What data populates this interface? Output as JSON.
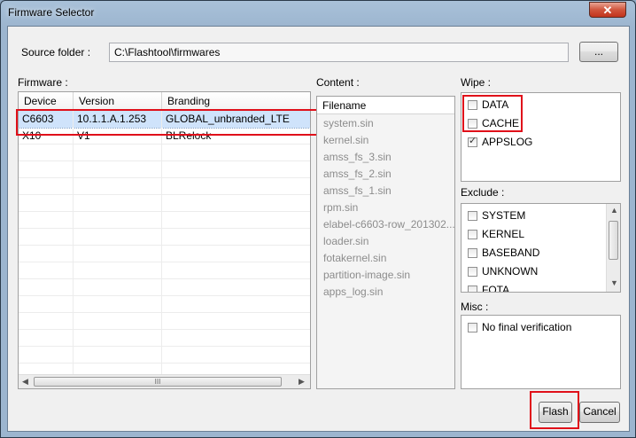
{
  "window": {
    "title": "Firmware Selector",
    "close_glyph": "✕"
  },
  "source": {
    "label": "Source folder :",
    "path": "C:\\Flashtool\\firmwares",
    "browse_label": "..."
  },
  "firmware": {
    "label": "Firmware :",
    "columns": [
      "Device",
      "Version",
      "Branding"
    ],
    "rows": [
      {
        "device": "C6603",
        "version": "10.1.1.A.1.253",
        "branding": "GLOBAL_unbranded_LTE",
        "selected": true
      },
      {
        "device": "X10",
        "version": "V1",
        "branding": "BLRelock",
        "selected": false
      }
    ],
    "hscroll_grip": "III"
  },
  "content": {
    "label": "Content :",
    "header": "Filename",
    "files": [
      "system.sin",
      "kernel.sin",
      "amss_fs_3.sin",
      "amss_fs_2.sin",
      "amss_fs_1.sin",
      "rpm.sin",
      "elabel-c6603-row_201302...",
      "loader.sin",
      "fotakernel.sin",
      "partition-image.sin",
      "apps_log.sin"
    ]
  },
  "wipe": {
    "label": "Wipe :",
    "items": [
      {
        "name": "DATA",
        "checked": false
      },
      {
        "name": "CACHE",
        "checked": false
      },
      {
        "name": "APPSLOG",
        "checked": true
      }
    ]
  },
  "exclude": {
    "label": "Exclude :",
    "items": [
      {
        "name": "SYSTEM",
        "checked": false
      },
      {
        "name": "KERNEL",
        "checked": false
      },
      {
        "name": "BASEBAND",
        "checked": false
      },
      {
        "name": "UNKNOWN",
        "checked": false
      },
      {
        "name": "FOTA",
        "checked": false
      }
    ]
  },
  "misc": {
    "label": "Misc :",
    "items": [
      {
        "name": "No final verification",
        "checked": false
      }
    ]
  },
  "actions": {
    "flash_label": "Flash",
    "cancel_label": "Cancel"
  },
  "colors": {
    "highlight_box": "#e0101a",
    "selected_row": "#cfe3fb"
  }
}
